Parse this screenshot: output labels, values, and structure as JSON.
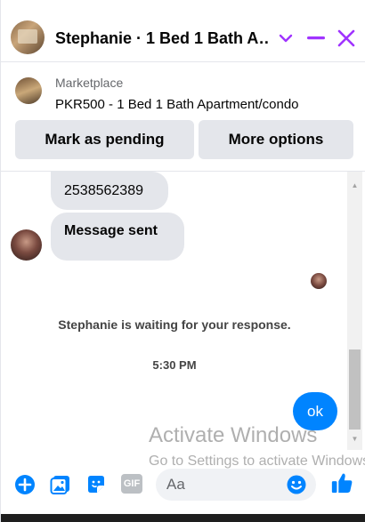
{
  "header": {
    "title": "Stephanie · 1 Bed 1 Bath A…",
    "icons": [
      "chevron-down-icon",
      "minimize-icon",
      "close-icon"
    ],
    "accent": "#a033ff"
  },
  "marketplace": {
    "label": "Marketplace",
    "item": "PKR500 - 1 Bed 1 Bath Apartment/condo",
    "buttons": [
      "Mark as pending",
      "More options"
    ]
  },
  "messages": {
    "phone": "2538562389",
    "sent_text": "Message sent",
    "waiting": "Stephanie is waiting for your response.",
    "time": "5:30 PM",
    "outgoing": "ok"
  },
  "watermark": {
    "line1": "Activate Windows",
    "line2": "Go to Settings to activate Windows."
  },
  "composer": {
    "placeholder": "Aa",
    "gif_label": "GIF",
    "accent": "#0084ff"
  }
}
